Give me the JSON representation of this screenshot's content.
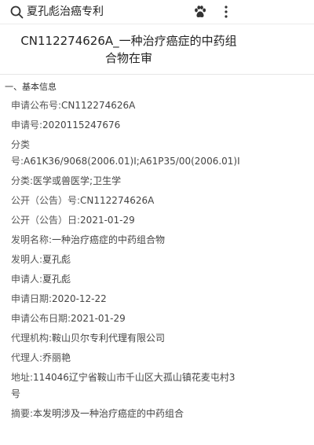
{
  "search": {
    "query": "夏孔彪治癌专利"
  },
  "title": "CN112274626A_一种治疗癌症的中药组合物在审",
  "section": {
    "heading": "一、基本信息"
  },
  "fields": [
    {
      "label": "申请公布号:",
      "value": "CN112274626A"
    },
    {
      "label": "申请号:",
      "value": "2020115247676"
    },
    {
      "label": "分类号:",
      "value": "A61K36/9068(2006.01)I;A61P35/00(2006.01)I"
    },
    {
      "label": "分类:",
      "value": "医学或兽医学;卫生学"
    },
    {
      "label": "公开（公告）号:",
      "value": "CN112274626A"
    },
    {
      "label": "公开（公告）日:",
      "value": "2021-01-29"
    },
    {
      "label": "发明名称:",
      "value": "一种治疗癌症的中药组合物"
    },
    {
      "label": "发明人:",
      "value": "夏孔彪"
    },
    {
      "label": "申请人:",
      "value": "夏孔彪"
    },
    {
      "label": "申请日期:",
      "value": "2020-12-22"
    },
    {
      "label": "申请公布日期:",
      "value": "2021-01-29"
    },
    {
      "label": "代理机构:",
      "value": "鞍山贝尔专利代理有限公司"
    },
    {
      "label": "代理人:",
      "value": "乔丽艳"
    },
    {
      "label": "地址:",
      "value": "114046辽宁省鞍山市千山区大孤山镇花麦屯村3号"
    },
    {
      "label": "摘要:",
      "value": "本发明涉及一种治疗癌症的中药组合"
    }
  ],
  "icons": {
    "search": "search-icon",
    "paw": "paw-icon",
    "more": "more-vertical-icon"
  }
}
